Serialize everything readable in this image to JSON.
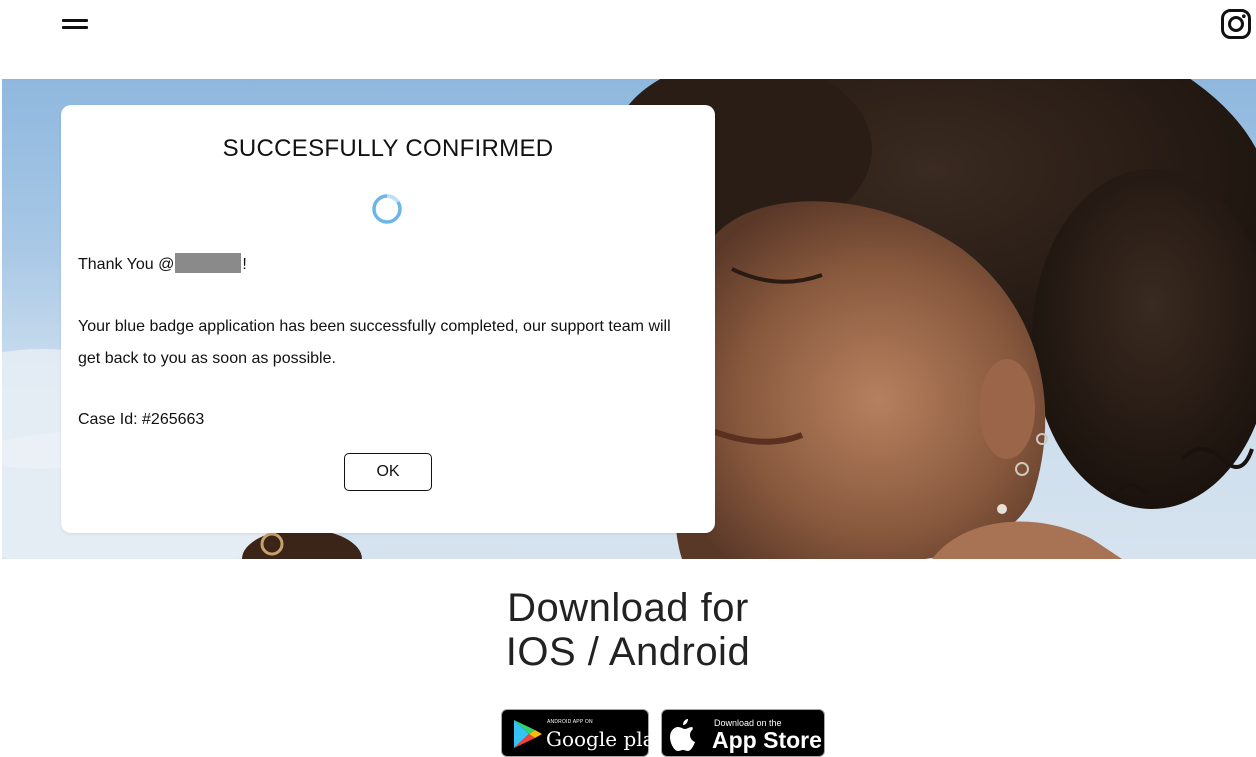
{
  "header": {
    "menu_icon": "hamburger-menu-icon",
    "social_icon": "instagram-icon"
  },
  "modal": {
    "title": "SUCCESFULLY CONFIRMED",
    "thanks_prefix": "Thank You @",
    "thanks_suffix": "!",
    "message": "Your blue badge application has been successfully completed, our support team will get back to you as soon as possible.",
    "case_id": "Case Id: #265663",
    "ok_label": "OK",
    "spinner_color": "#5aaee6"
  },
  "download": {
    "line1": "Download for",
    "line2": "IOS / Android",
    "google_play": {
      "small": "ANDROID APP ON",
      "big": "Google play"
    },
    "app_store": {
      "small": "Download on the",
      "big": "App Store"
    }
  }
}
